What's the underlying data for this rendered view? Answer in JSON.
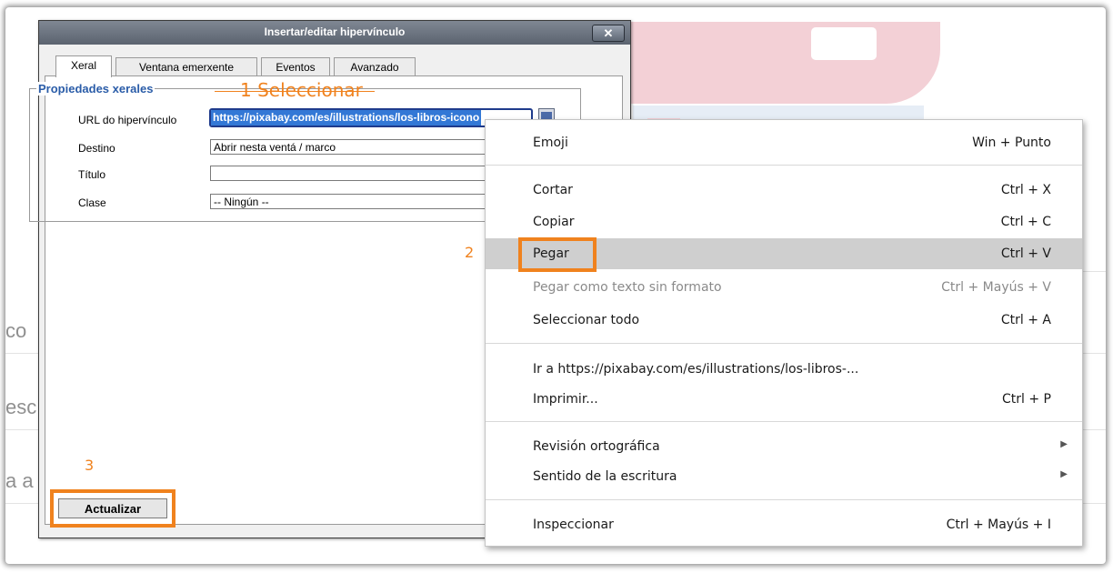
{
  "dialog": {
    "title": "Insertar/editar hipervínculo",
    "close": "✕",
    "tabs": [
      "Xeral",
      "Ventana emerxente",
      "Eventos",
      "Avanzado"
    ],
    "fieldset_legend": "Propiedades xerales",
    "fields": {
      "url_label": "URL do hipervínculo",
      "url_value": "https://pixabay.com/es/illustrations/los-libros-icono",
      "target_label": "Destino",
      "target_value": "Abrir nesta ventá / marco",
      "title_label": "Título",
      "title_value": "",
      "class_label": "Clase",
      "class_value": "-- Ningún --"
    },
    "update_button": "Actualizar"
  },
  "annotations": {
    "step1": "1 Seleccionar",
    "step2": "2",
    "step3": "3"
  },
  "context_menu": {
    "items": [
      {
        "label": "Emoji",
        "shortcut": "Win + Punto"
      },
      {
        "label": "Cortar",
        "shortcut": "Ctrl + X"
      },
      {
        "label": "Copiar",
        "shortcut": "Ctrl + C"
      },
      {
        "label": "Pegar",
        "shortcut": "Ctrl + V"
      },
      {
        "label": "Pegar como texto sin formato",
        "shortcut": "Ctrl + Mayús + V"
      },
      {
        "label": "Seleccionar todo",
        "shortcut": "Ctrl + A"
      },
      {
        "label": "Ir a https://pixabay.com/es/illustrations/los-libros-...",
        "shortcut": ""
      },
      {
        "label": "Imprimir...",
        "shortcut": "Ctrl + P"
      },
      {
        "label": "Revisión ortográfica",
        "shortcut": ""
      },
      {
        "label": "Sentido de la escritura",
        "shortcut": ""
      },
      {
        "label": "Inspeccionar",
        "shortcut": "Ctrl + Mayús + I"
      }
    ],
    "submenu_arrow": "▶"
  },
  "background": {
    "fragments": [
      "co",
      "esc",
      "a a"
    ]
  },
  "colors": {
    "annotation": "#f0821e",
    "selection": "#3378d6",
    "legend": "#2a5ca8",
    "menu_highlight": "#cfcfcf"
  }
}
